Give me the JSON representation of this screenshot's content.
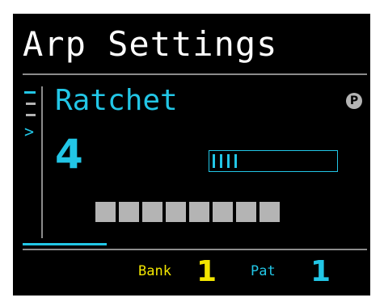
{
  "header": {
    "title": "Arp Settings"
  },
  "parameter": {
    "name": "Ratchet",
    "value": "4",
    "level_fraction": 0.25,
    "badge": "P",
    "badge_icon": "p-badge-icon"
  },
  "side_nav": {
    "chevron": ">"
  },
  "steps": {
    "count": 8
  },
  "footer": {
    "bank_label": "Bank",
    "bank_value": "1",
    "pat_label": "Pat",
    "pat_value": "1"
  },
  "colors": {
    "background": "#000000",
    "accent_cyan": "#22c6e6",
    "accent_yellow": "#f2e600",
    "text_white": "#ffffff",
    "step_grey": "#b4b4b4",
    "divider_grey": "#8c8c8c"
  }
}
